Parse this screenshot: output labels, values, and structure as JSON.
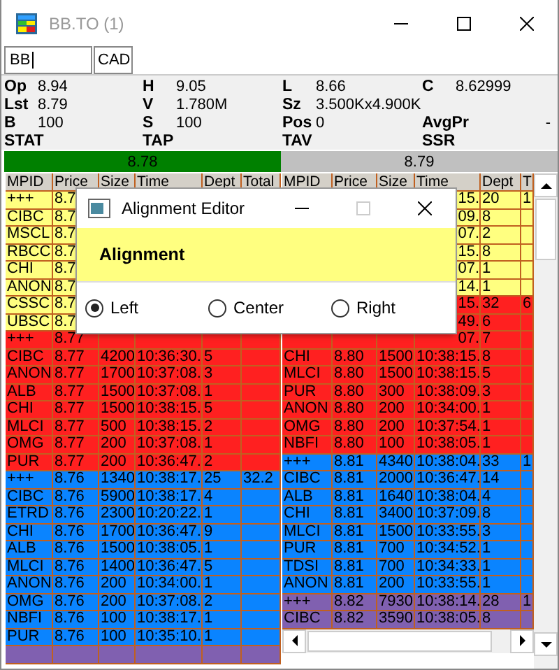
{
  "window": {
    "title": "BB.TO (1)"
  },
  "symbol_field": {
    "value": "BB"
  },
  "currency": "CAD",
  "quote_rows": [
    [
      {
        "label": "Op",
        "value": "8.94"
      },
      {
        "label": "H",
        "value": "9.05"
      },
      {
        "label": "L",
        "value": "8.66"
      },
      {
        "label": "C",
        "value": "8.62999"
      }
    ],
    [
      {
        "label": "Lst",
        "value": "8.79"
      },
      {
        "label": "V",
        "value": "1.780M"
      },
      {
        "label": "Sz",
        "value": "3.500Kx4.900K"
      }
    ],
    [
      {
        "label": "B",
        "value": "100"
      },
      {
        "label": "S",
        "value": "100"
      },
      {
        "label": "Pos",
        "value": "0"
      },
      {
        "label": "AvgPr",
        "value": "-"
      }
    ],
    [
      {
        "label": "STAT"
      },
      {
        "label": "TAP"
      },
      {
        "label": "TAV"
      },
      {
        "label": "SSR"
      }
    ]
  ],
  "bid_bar": {
    "value": "8.78"
  },
  "ask_bar": {
    "value": "8.79"
  },
  "bid_book": {
    "columns": [
      "MPID",
      "Price",
      "Size",
      "Time",
      "Dept",
      "Total"
    ],
    "rows": [
      {
        "mpid": "+++",
        "price": "8.7",
        "color": "#ffff80"
      },
      {
        "mpid": "CIBC",
        "price": "8.7",
        "color": "#ffff80"
      },
      {
        "mpid": "MSCL",
        "price": "8.7",
        "color": "#ffff80"
      },
      {
        "mpid": "RBCC",
        "price": "8.7",
        "color": "#ffff80"
      },
      {
        "mpid": "CHI",
        "price": "8.7",
        "color": "#ffff80"
      },
      {
        "mpid": "ANON",
        "price": "8.7",
        "color": "#ffff80"
      },
      {
        "mpid": "CSSC",
        "price": "8.7",
        "color": "#ffff80"
      },
      {
        "mpid": "UBSC",
        "price": "8.7",
        "color": "#ffff80"
      },
      {
        "mpid": "+++",
        "price": "8.77",
        "color": "#ff2020"
      },
      {
        "mpid": "CIBC",
        "price": "8.77",
        "size": "4200",
        "time": "10:36:30.",
        "depth": "5",
        "color": "#ff2020"
      },
      {
        "mpid": "ANON",
        "price": "8.77",
        "size": "1700",
        "time": "10:37:08.",
        "depth": "3",
        "color": "#ff2020"
      },
      {
        "mpid": "ALB",
        "price": "8.77",
        "size": "1500",
        "time": "10:37:08.",
        "depth": "1",
        "color": "#ff2020"
      },
      {
        "mpid": "CHI",
        "price": "8.77",
        "size": "1500",
        "time": "10:38:15.",
        "depth": "5",
        "color": "#ff2020"
      },
      {
        "mpid": "MLCI",
        "price": "8.77",
        "size": "500",
        "time": "10:38:15.",
        "depth": "2",
        "color": "#ff2020"
      },
      {
        "mpid": "OMG",
        "price": "8.77",
        "size": "200",
        "time": "10:37:08.",
        "depth": "1",
        "color": "#ff2020"
      },
      {
        "mpid": "PUR",
        "price": "8.77",
        "size": "200",
        "time": "10:36:47.",
        "depth": "2",
        "color": "#ff2020"
      },
      {
        "mpid": "+++",
        "price": "8.76",
        "size": "1340",
        "time": "10:38:17.",
        "depth": "25",
        "total": "32.2",
        "color": "#0a84ff"
      },
      {
        "mpid": "CIBC",
        "price": "8.76",
        "size": "5900",
        "time": "10:38:17.",
        "depth": "4",
        "color": "#0a84ff"
      },
      {
        "mpid": "ETRD",
        "price": "8.76",
        "size": "2300",
        "time": "10:20:22.",
        "depth": "1",
        "color": "#0a84ff"
      },
      {
        "mpid": "CHI",
        "price": "8.76",
        "size": "1700",
        "time": "10:36:47.",
        "depth": "9",
        "color": "#0a84ff"
      },
      {
        "mpid": "ALB",
        "price": "8.76",
        "size": "1500",
        "time": "10:38:05.",
        "depth": "1",
        "color": "#0a84ff"
      },
      {
        "mpid": "MLCI",
        "price": "8.76",
        "size": "1400",
        "time": "10:36:47.",
        "depth": "5",
        "color": "#0a84ff"
      },
      {
        "mpid": "ANON",
        "price": "8.76",
        "size": "200",
        "time": "10:34:00.",
        "depth": "1",
        "color": "#0a84ff"
      },
      {
        "mpid": "OMG",
        "price": "8.76",
        "size": "200",
        "time": "10:37:08.",
        "depth": "2",
        "color": "#0a84ff"
      },
      {
        "mpid": "NBFI",
        "price": "8.76",
        "size": "100",
        "time": "10:38:17.",
        "depth": "1",
        "color": "#0a84ff"
      },
      {
        "mpid": "PUR",
        "price": "8.76",
        "size": "100",
        "time": "10:35:10.",
        "depth": "1",
        "color": "#0a84ff"
      },
      {
        "color": "#8060b0"
      }
    ]
  },
  "ask_book": {
    "columns": [
      "MPID",
      "Price",
      "Size",
      "Time",
      "Dept",
      "T"
    ],
    "rows": [
      {
        "time": "15.",
        "depth": "20",
        "total": "1",
        "color": "#ffff80"
      },
      {
        "time": "09.",
        "depth": "8",
        "color": "#ffff80"
      },
      {
        "time": "07.",
        "depth": "2",
        "color": "#ffff80"
      },
      {
        "time": "15.",
        "depth": "8",
        "color": "#ffff80"
      },
      {
        "time": "07.",
        "depth": "1",
        "color": "#ffff80"
      },
      {
        "time": "14.",
        "depth": "1",
        "color": "#ffff80"
      },
      {
        "time": "15.",
        "depth": "32",
        "total": "6",
        "color": "#ff2020"
      },
      {
        "time": "49.",
        "depth": "6",
        "color": "#ff2020"
      },
      {
        "time": "07.",
        "depth": "7",
        "color": "#ff2020"
      },
      {
        "mpid": "CHI",
        "price": "8.80",
        "size": "1500",
        "time": "10:38:15.",
        "depth": "8",
        "color": "#ff2020"
      },
      {
        "mpid": "MLCI",
        "price": "8.80",
        "size": "1500",
        "time": "10:38:15.",
        "depth": "5",
        "color": "#ff2020"
      },
      {
        "mpid": "PUR",
        "price": "8.80",
        "size": "300",
        "time": "10:38:09.",
        "depth": "3",
        "color": "#ff2020"
      },
      {
        "mpid": "ANON",
        "price": "8.80",
        "size": "200",
        "time": "10:34:00.",
        "depth": "1",
        "color": "#ff2020"
      },
      {
        "mpid": "OMG",
        "price": "8.80",
        "size": "200",
        "time": "10:37:54.",
        "depth": "1",
        "color": "#ff2020"
      },
      {
        "mpid": "NBFI",
        "price": "8.80",
        "size": "100",
        "time": "10:38:05.",
        "depth": "1",
        "color": "#ff2020"
      },
      {
        "mpid": "+++",
        "price": "8.81",
        "size": "4340",
        "time": "10:38:04.",
        "depth": "33",
        "total": "1",
        "color": "#0a84ff"
      },
      {
        "mpid": "CIBC",
        "price": "8.81",
        "size": "2000",
        "time": "10:36:47.",
        "depth": "14",
        "color": "#0a84ff"
      },
      {
        "mpid": "ALB",
        "price": "8.81",
        "size": "1640",
        "time": "10:38:04.",
        "depth": "4",
        "color": "#0a84ff"
      },
      {
        "mpid": "CHI",
        "price": "8.81",
        "size": "3400",
        "time": "10:37:09.",
        "depth": "8",
        "color": "#0a84ff"
      },
      {
        "mpid": "MLCI",
        "price": "8.81",
        "size": "1500",
        "time": "10:33:55.",
        "depth": "3",
        "color": "#0a84ff"
      },
      {
        "mpid": "PUR",
        "price": "8.81",
        "size": "700",
        "time": "10:34:52.",
        "depth": "1",
        "color": "#0a84ff"
      },
      {
        "mpid": "TDSI",
        "price": "8.81",
        "size": "700",
        "time": "10:34:33.",
        "depth": "1",
        "color": "#0a84ff"
      },
      {
        "mpid": "ANON",
        "price": "8.81",
        "size": "200",
        "time": "10:33:55.",
        "depth": "1",
        "color": "#0a84ff"
      },
      {
        "mpid": "+++",
        "price": "8.82",
        "size": "7930",
        "time": "10:38:14.",
        "depth": "28",
        "total": "1",
        "color": "#8060b0"
      },
      {
        "mpid": "CIBC",
        "price": "8.82",
        "size": "3590",
        "time": "10:38:05.",
        "depth": "8",
        "color": "#8060b0"
      }
    ]
  },
  "dialog": {
    "title": "Alignment Editor",
    "heading": "Alignment",
    "options": [
      {
        "label": "Left",
        "selected": true
      },
      {
        "label": "Center",
        "selected": false
      },
      {
        "label": "Right",
        "selected": false
      }
    ]
  }
}
